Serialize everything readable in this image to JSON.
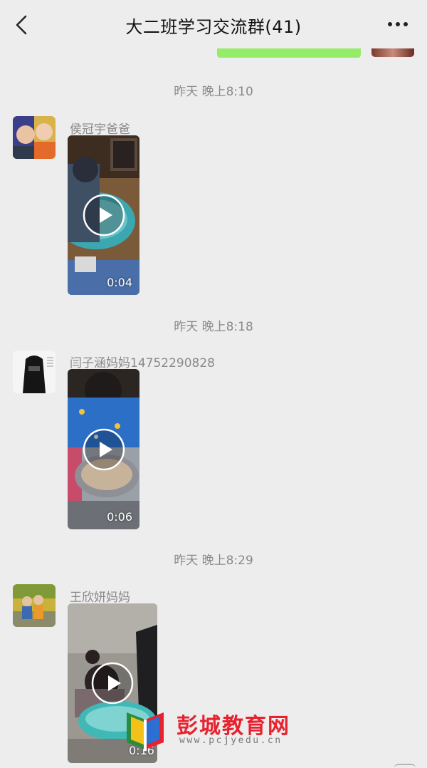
{
  "header": {
    "title": "大二班学习交流群(41)",
    "back_icon": "chevron-left-icon",
    "more_icon": "more-dots-icon"
  },
  "messages": [
    {
      "timestamp": "昨天 晚上8:10",
      "sender": "侯冠宇爸爸",
      "video_duration": "0:04"
    },
    {
      "timestamp": "昨天 晚上8:18",
      "sender": "闫子涵妈妈14752290828",
      "video_duration": "0:06"
    },
    {
      "timestamp": "昨天 晚上8:29",
      "sender": "王欣妍妈妈",
      "video_duration": "0:16"
    }
  ],
  "watermark": {
    "title": "彭城教育网",
    "url": "www.pcjyedu.cn"
  },
  "colors": {
    "background": "#ededed",
    "self_bubble": "#95ec69",
    "watermark_red": "#e8212e"
  }
}
